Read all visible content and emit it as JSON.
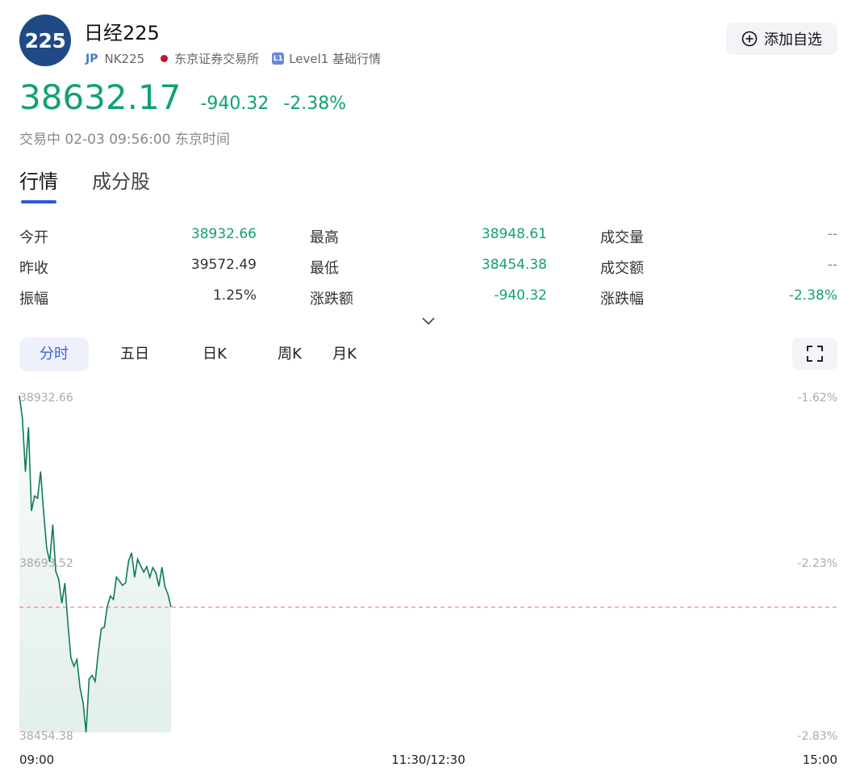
{
  "header": {
    "logo_text": "225",
    "title": "日经225",
    "market_code": "JP",
    "ticker": "NK225",
    "exchange": "东京证券交易所",
    "level_badge": "L1",
    "level_text": "Level1 基础行情",
    "add_button": "添加自选"
  },
  "quote": {
    "price": "38632.17",
    "change": "-940.32",
    "change_pct": "-2.38%",
    "status": "交易中 02-03 09:56:00 东京时间"
  },
  "tabs": [
    {
      "label": "行情",
      "active": true
    },
    {
      "label": "成分股",
      "active": false
    }
  ],
  "stats": [
    [
      {
        "label": "今开",
        "value": "38932.66",
        "tone": "green"
      },
      {
        "label": "最高",
        "value": "38948.61",
        "tone": "green"
      },
      {
        "label": "成交量",
        "value": "--",
        "tone": "gray"
      }
    ],
    [
      {
        "label": "昨收",
        "value": "39572.49",
        "tone": "normal"
      },
      {
        "label": "最低",
        "value": "38454.38",
        "tone": "green"
      },
      {
        "label": "成交额",
        "value": "--",
        "tone": "gray"
      }
    ],
    [
      {
        "label": "振幅",
        "value": "1.25%",
        "tone": "normal"
      },
      {
        "label": "涨跌额",
        "value": "-940.32",
        "tone": "green"
      },
      {
        "label": "涨跌幅",
        "value": "-2.38%",
        "tone": "green"
      }
    ]
  ],
  "period_tabs": [
    {
      "label": "分时",
      "active": true
    },
    {
      "label": "五日",
      "active": false
    },
    {
      "label": "日K",
      "active": false
    },
    {
      "label": "周K",
      "active": false
    },
    {
      "label": "月K",
      "active": false
    }
  ],
  "colors": {
    "accent": "#3d63d6",
    "down": "#12a26b",
    "line": "#0f7a5c",
    "ref_line": "#f08a7a"
  },
  "chart_data": {
    "type": "line",
    "y_left_ticks": [
      "38932.66",
      "38693.52",
      "38454.38"
    ],
    "y_right_ticks": [
      "-1.62%",
      "-2.23%",
      "-2.83%"
    ],
    "x_ticks": [
      "09:00",
      "11:30/12:30",
      "15:00"
    ],
    "ylim": [
      38454.38,
      38932.66
    ],
    "reference_value": 38632.17,
    "series": [
      {
        "values": [
          38932.7,
          38899.9,
          38824.6,
          38887.7,
          38768.8,
          38790.2,
          38786.9,
          38825.1,
          38767.0,
          38716.7,
          38696.7,
          38749.5,
          38683.4,
          38671.2,
          38637.9,
          38666.5,
          38608.7,
          38560.1,
          38548.3,
          38557.8,
          38517.8,
          38496.4,
          38454.4,
          38530.4,
          38535.2,
          38526.7,
          38567.5,
          38601.6,
          38603.6,
          38633.3,
          38648.1,
          38643.2,
          38675.1,
          38669.3,
          38663.1,
          38666.8,
          38697.8,
          38709.3,
          38674.7,
          38700.5,
          38690.7,
          38682.1,
          38689.9,
          38674.7,
          38688.5,
          38681.3,
          38661.7,
          38689.0,
          38660.9,
          38650.5,
          38632.2
        ]
      }
    ]
  }
}
